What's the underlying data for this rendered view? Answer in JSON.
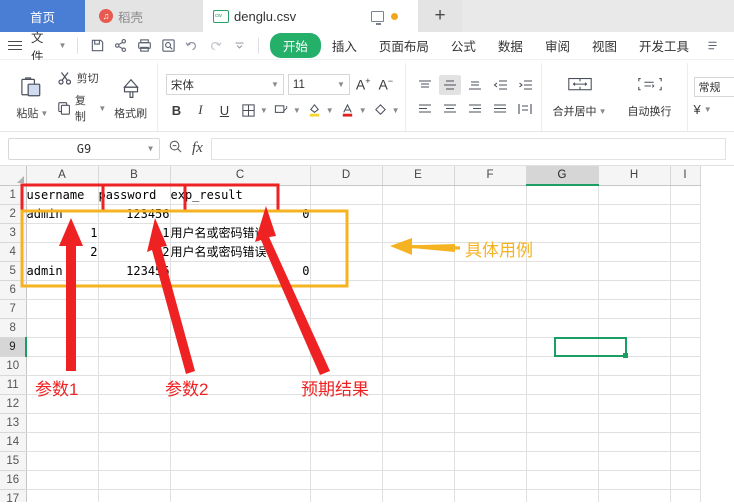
{
  "window": {
    "tabs": [
      {
        "label": "首页",
        "type": "home"
      },
      {
        "label": "稻壳",
        "type": "docer",
        "icon": "docer-icon"
      },
      {
        "label": "denglu.csv",
        "type": "file",
        "icon": "csv-file-icon"
      }
    ],
    "new_tab_label": "+"
  },
  "menu": {
    "file_label": "文件",
    "quick_access": [
      "save-icon",
      "share-icon",
      "print-icon",
      "print-preview-icon",
      "undo-icon",
      "redo-icon",
      "customize-qat-icon"
    ],
    "ribbon_tabs": [
      {
        "label": "开始",
        "active": true
      },
      {
        "label": "插入",
        "active": false
      },
      {
        "label": "页面布局",
        "active": false
      },
      {
        "label": "公式",
        "active": false
      },
      {
        "label": "数据",
        "active": false
      },
      {
        "label": "审阅",
        "active": false
      },
      {
        "label": "视图",
        "active": false
      },
      {
        "label": "开发工具",
        "active": false
      }
    ]
  },
  "ribbon": {
    "clipboard": {
      "paste": "粘贴",
      "cut": "剪切",
      "copy": "复制",
      "format_painter": "格式刷"
    },
    "font": {
      "family": "宋体",
      "size": "11",
      "grow_label": "A",
      "shrink_label": "A",
      "bold": "B",
      "italic": "I",
      "underline": "U",
      "border": "border-icon",
      "effects": "text-effect-icon",
      "fill_color": "fill-color-icon",
      "font_color": "font-color-icon",
      "clear_format": "clear-format-icon"
    },
    "alignment": {
      "merge_center": "合并居中",
      "wrap_text": "自动换行"
    },
    "number": {
      "format": "常规",
      "currency": "¥"
    }
  },
  "formula_bar": {
    "name_box": "G9",
    "formula_value": "",
    "fx_label": "fx",
    "zoom_icon": "zoom-icon"
  },
  "sheet": {
    "columns": [
      "A",
      "B",
      "C",
      "D",
      "E",
      "F",
      "G",
      "H",
      "I"
    ],
    "selected_column": "G",
    "selected_row": 9,
    "selected_cell": "G9",
    "rows": [
      {
        "n": 1,
        "cells": {
          "A": "username",
          "B": "password",
          "C": "exp_result"
        }
      },
      {
        "n": 2,
        "cells": {
          "A": "admin",
          "B": "123456",
          "C": "0"
        }
      },
      {
        "n": 3,
        "cells": {
          "A": "1",
          "B": "1",
          "C": "用户名或密码错误！"
        }
      },
      {
        "n": 4,
        "cells": {
          "A": "2",
          "B": "2",
          "C": "用户名或密码错误！"
        }
      },
      {
        "n": 5,
        "cells": {
          "A": "admin",
          "B": "123456",
          "C": "0"
        }
      },
      {
        "n": 6,
        "cells": {}
      },
      {
        "n": 7,
        "cells": {}
      },
      {
        "n": 8,
        "cells": {}
      },
      {
        "n": 9,
        "cells": {}
      },
      {
        "n": 10,
        "cells": {}
      },
      {
        "n": 11,
        "cells": {}
      },
      {
        "n": 12,
        "cells": {}
      },
      {
        "n": 13,
        "cells": {}
      },
      {
        "n": 14,
        "cells": {}
      },
      {
        "n": 15,
        "cells": {}
      },
      {
        "n": 16,
        "cells": {}
      },
      {
        "n": 17,
        "cells": {}
      }
    ]
  },
  "annotations": {
    "color_red": "#ee2222",
    "color_orange": "#f5b321",
    "labels": [
      {
        "text": "参数1",
        "color": "#ee2222"
      },
      {
        "text": "参数2",
        "color": "#ee2222"
      },
      {
        "text": "预期结果",
        "color": "#ee2222"
      },
      {
        "text": "具体用例",
        "color": "#f5b321"
      }
    ]
  }
}
